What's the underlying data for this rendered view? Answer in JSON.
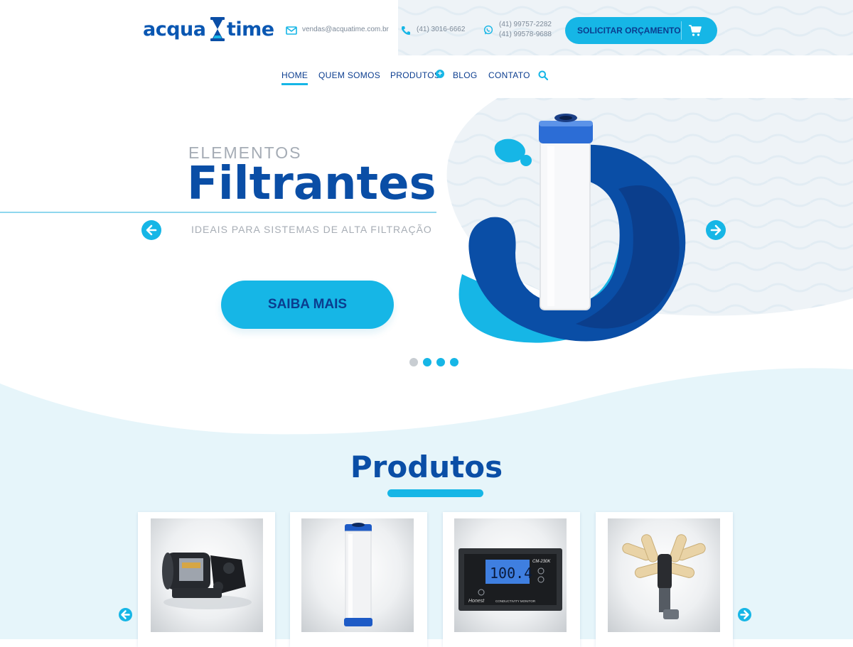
{
  "brand": {
    "logo_left": "acqua",
    "logo_right": "time",
    "primary_color": "#0a4ea6",
    "accent_color": "#16b6e6"
  },
  "contacts": {
    "email": "vendas@acquatime.com.br",
    "phone": "(41)  3016-6662",
    "whatsapp_1": "(41) 99757-2282",
    "whatsapp_2": "(41) 99578-9688",
    "icons": [
      "envelope-icon",
      "phone-icon",
      "whatsapp-icon"
    ]
  },
  "cta": {
    "label": "SOLICITAR ORÇAMENTO",
    "icon": "cart-icon"
  },
  "nav": {
    "items": [
      {
        "label": "HOME",
        "active": true
      },
      {
        "label": "QUEM SOMOS",
        "active": false
      },
      {
        "label": "PRODUTOS",
        "active": false
      },
      {
        "label": "BLOG",
        "active": false
      },
      {
        "label": "CONTATO",
        "active": false
      }
    ],
    "search_icon": "search-icon"
  },
  "hero": {
    "kicker": "ELEMENTOS",
    "title": "Filtrantes",
    "subtitle": "IDEAIS PARA SISTEMAS DE ALTA FILTRAÇÃO",
    "button": "SAIBA MAIS",
    "slides_total": 4,
    "active_slide_index": 1
  },
  "products": {
    "title": "Produtos",
    "items": [
      {
        "image": "booster-pump"
      },
      {
        "image": "filter-cartridge"
      },
      {
        "image": "conductivity-monitor"
      },
      {
        "image": "nozzle-distributor"
      }
    ],
    "monitor_display": "100.4",
    "monitor_model": "CM-230K",
    "monitor_brand": "Honest",
    "monitor_caption": "CONDUCTIVITY MONITOR"
  }
}
